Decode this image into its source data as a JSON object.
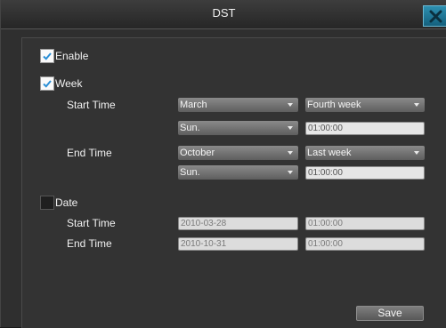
{
  "window": {
    "title": "DST"
  },
  "enable": {
    "label": "Enable",
    "checked": true
  },
  "week": {
    "label": "Week",
    "checked": true,
    "start_label": "Start Time",
    "end_label": "End Time",
    "start": {
      "month": "March",
      "week": "Fourth week",
      "day": "Sun.",
      "time": "01:00:00"
    },
    "end": {
      "month": "October",
      "week": "Last week",
      "day": "Sun.",
      "time": "01:00:00"
    }
  },
  "date": {
    "label": "Date",
    "checked": false,
    "start_label": "Start Time",
    "end_label": "End Time",
    "start": {
      "date": "2010-03-28",
      "time": "01:00:00"
    },
    "end": {
      "date": "2010-10-31",
      "time": "01:00:00"
    }
  },
  "buttons": {
    "save": "Save"
  },
  "colors": {
    "close_button": "#1d7698",
    "check_mark": "#2a8fd6"
  }
}
